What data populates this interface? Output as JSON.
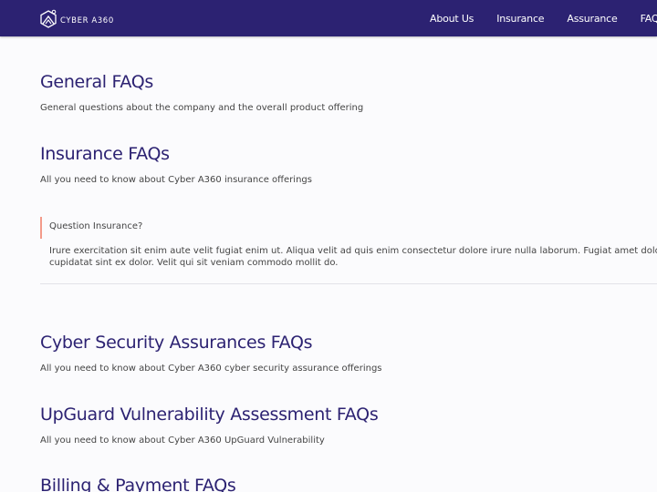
{
  "navbar": {
    "logo_text": "CYBER A360",
    "links": [
      "About Us",
      "Insurance",
      "Assurance",
      "FAQs"
    ]
  },
  "sections": [
    {
      "title": "General FAQs",
      "description": "General questions about the company and the overall product offering"
    },
    {
      "title": "Insurance FAQs",
      "description": "All you need to know about Cyber A360 insurance offerings"
    },
    {
      "title": "Cyber Security Assurances FAQs",
      "description": "All you need to know about Cyber A360 cyber security assurance offerings"
    },
    {
      "title": "UpGuard Vulnerability Assessment FAQs",
      "description": "All you need to know about Cyber A360 UpGuard Vulnerability"
    },
    {
      "title": "Billing & Payment FAQs",
      "description": ""
    }
  ],
  "faq": {
    "question": "Question Insurance?",
    "answer_line1": "Irure exercitation sit enim aute velit fugiat enim ut. Aliqua velit ad quis enim consectetur dolore irure nulla laborum. Fugiat amet dolor",
    "answer_line2": "cupidatat sint ex dolor. Velit qui sit veniam commodo mollit do."
  },
  "colors": {
    "navbar_bg": "#2c2272",
    "heading": "#2c2272",
    "accent_bar": "#f39a8a",
    "background": "#fbfbfd"
  },
  "icons": {
    "logo": "shield-hexagon-logo-icon"
  }
}
